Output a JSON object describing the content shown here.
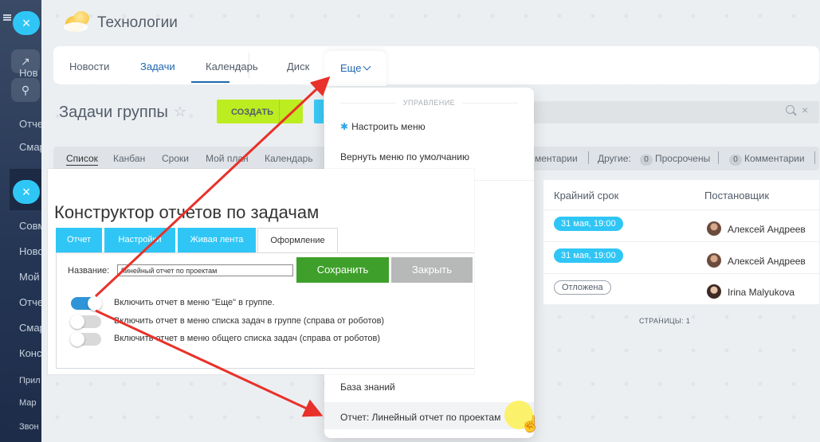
{
  "app": {
    "title": "Технологии"
  },
  "sidebar": {
    "close_glyph": "×",
    "items": [
      "Нов",
      "Отче",
      "Смар",
      "Совм",
      "Ново",
      "Мой",
      "Отче",
      "Смар",
      "Конс",
      "Прил",
      "Мар",
      "Звон"
    ]
  },
  "topnav": {
    "items": [
      "Новости",
      "Задачи",
      "Календарь",
      "Диск"
    ],
    "separator": "›",
    "more": "Еще"
  },
  "page": {
    "title": "Задачи группы",
    "create_label": "СОЗДАТЬ"
  },
  "viewbar": {
    "views": [
      "Список",
      "Канбан",
      "Сроки",
      "Мой план",
      "Календарь"
    ],
    "counters_cut": "ментарии",
    "others_label": "Другие:",
    "counter1_value": "0",
    "counter1_label": "Просрочены",
    "counter2_value": "0",
    "counter2_label": "Комментарии"
  },
  "table": {
    "headers": [
      "Крайний срок",
      "Постановщик"
    ],
    "rows": [
      {
        "deadline": "31 мая, 19:00",
        "author": "Алексей Андреев"
      },
      {
        "deadline": "31 мая, 19:00",
        "author": "Алексей Андреев"
      },
      {
        "deadline": "Отложена",
        "author": "Irina Malyukova"
      }
    ],
    "pages": "СТРАНИЦЫ: 1"
  },
  "menu": {
    "section": "УПРАВЛЕНИЕ",
    "items": [
      "Настроить меню",
      "Вернуть меню по умолчанию",
      "База знаний",
      "Отчет: Линейный отчет по проектам"
    ]
  },
  "panel": {
    "title": "Конструктор отчетов по задачам",
    "tabs": [
      "Отчет",
      "Настройки",
      "Живая лента",
      "Оформление"
    ],
    "name_label": "Название:",
    "name_value": "Линейный отчет по проектам",
    "save_label": "Сохранить",
    "close_label": "Закрыть",
    "toggles": [
      {
        "label": "Включить отчет в меню \"Еще\" в группе.",
        "on": true
      },
      {
        "label": "Включить отчет в меню списка задач в группе (справа от роботов)",
        "on": false
      },
      {
        "label": "Включить отчет в меню общего списка задач (справа от роботов)",
        "on": false
      }
    ]
  },
  "colors": {
    "accent": "#2fc6f6",
    "arrow": "#e8312a",
    "save": "#3ea02a",
    "create": "#bbed21"
  }
}
